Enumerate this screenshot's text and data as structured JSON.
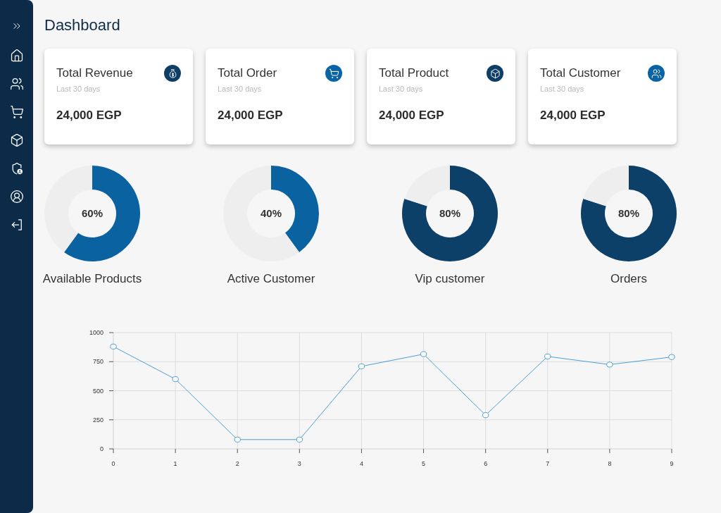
{
  "page_title": "Dashboard",
  "cards": [
    {
      "title": "Total Revenue",
      "subtitle": "Last 30 days",
      "value": "24,000 EGP",
      "color": "#0e3d66"
    },
    {
      "title": "Total Order",
      "subtitle": "Last 30 days",
      "value": "24,000 EGP",
      "color": "#0a64a4"
    },
    {
      "title": "Total Product",
      "subtitle": "Last 30 days",
      "value": "24,000 EGP",
      "color": "#0e3d66"
    },
    {
      "title": "Total Customer",
      "subtitle": "Last 30 days",
      "value": "24,000 EGP",
      "color": "#0a64a4"
    }
  ],
  "donuts": [
    {
      "reading": "60%",
      "label": "Available Products",
      "color": "#0a62a0",
      "chart_data": {
        "type": "donut",
        "values": [
          60,
          40
        ]
      }
    },
    {
      "reading": "40%",
      "label": "Active Customer",
      "color": "#0a62a0",
      "chart_data": {
        "type": "donut",
        "values": [
          40,
          60
        ]
      }
    },
    {
      "reading": "80%",
      "label": "Vip customer",
      "color": "#0d4068",
      "chart_data": {
        "type": "donut",
        "values": [
          80,
          20
        ]
      }
    },
    {
      "reading": "80%",
      "label": "Orders",
      "color": "#0d4068",
      "chart_data": {
        "type": "donut",
        "values": [
          80,
          20
        ]
      }
    }
  ],
  "line_chart": {
    "chart_data": {
      "type": "line",
      "x": [
        0,
        1,
        2,
        3,
        4,
        5,
        6,
        7,
        8,
        9
      ],
      "series": [
        {
          "color": "#4a9fd8",
          "marker": "circle",
          "values": [
            880,
            600,
            80,
            80,
            710,
            815,
            290,
            795,
            725,
            790
          ]
        }
      ],
      "xlim": [
        0,
        9
      ],
      "ylim": [
        0,
        1000
      ],
      "xticks": [
        0,
        1,
        2,
        3,
        4,
        5,
        6,
        7,
        8,
        9
      ],
      "yticks": [
        0,
        250,
        500,
        750,
        1000
      ],
      "grid": true
    }
  }
}
